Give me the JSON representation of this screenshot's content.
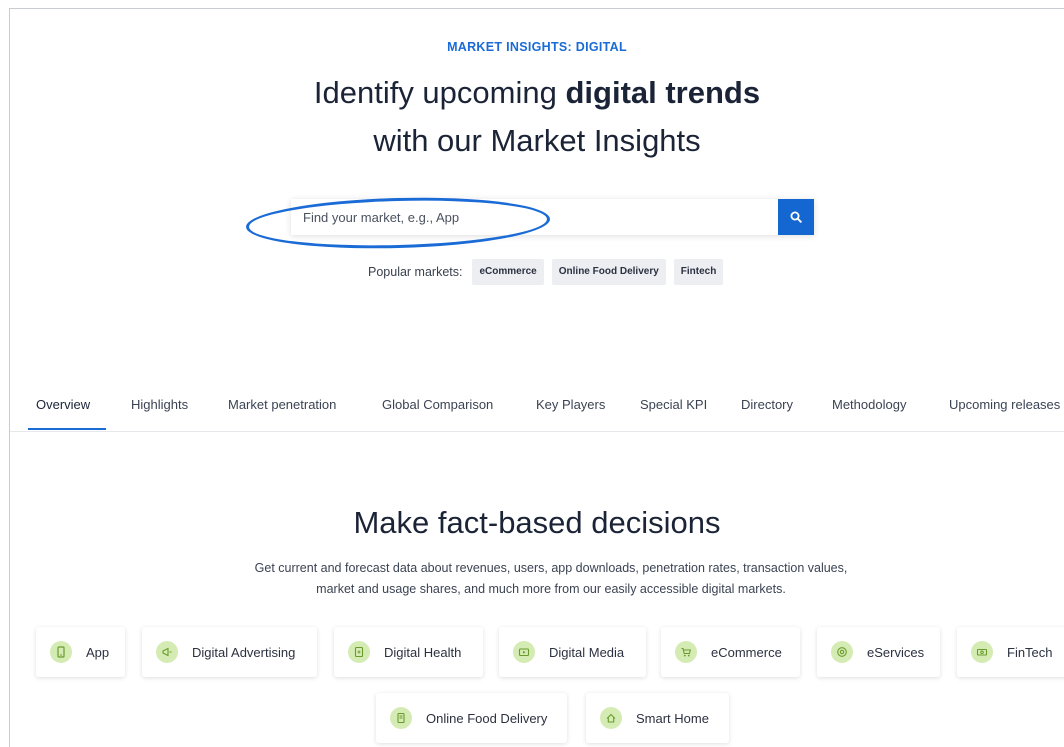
{
  "hero": {
    "eyebrow": "MARKET INSIGHTS: DIGITAL",
    "headline_pre": "Identify upcoming ",
    "headline_bold": "digital trends",
    "headline_line2": "with our Market Insights"
  },
  "search": {
    "value": "",
    "placeholder": "Find your market, e.g., App",
    "button_icon": "search-icon"
  },
  "popular": {
    "label": "Popular markets:",
    "chips": [
      "eCommerce",
      "Online Food Delivery",
      "Fintech"
    ]
  },
  "tabs": [
    {
      "label": "Overview",
      "active": true
    },
    {
      "label": "Highlights"
    },
    {
      "label": "Market penetration"
    },
    {
      "label": "Global Comparison"
    },
    {
      "label": "Key Players"
    },
    {
      "label": "Special KPI"
    },
    {
      "label": "Directory"
    },
    {
      "label": "Methodology"
    },
    {
      "label": "Upcoming releases"
    }
  ],
  "section": {
    "title": "Make fact-based decisions",
    "subtitle_line1": "Get current and forecast data about revenues, users, app downloads, penetration rates, transaction values,",
    "subtitle_line2": "market and usage shares, and much more from our easily accessible digital markets."
  },
  "markets": [
    {
      "label": "App",
      "icon": "phone-icon"
    },
    {
      "label": "Digital Advertising",
      "icon": "megaphone-icon"
    },
    {
      "label": "Digital Health",
      "icon": "health-device-icon"
    },
    {
      "label": "Digital Media",
      "icon": "media-icon"
    },
    {
      "label": "eCommerce",
      "icon": "cart-icon"
    },
    {
      "label": "eServices",
      "icon": "at-sign-icon"
    },
    {
      "label": "FinTech",
      "icon": "banknote-icon"
    },
    {
      "label": "Online Food Delivery",
      "icon": "food-delivery-icon"
    },
    {
      "label": "Smart Home",
      "icon": "smart-home-icon"
    }
  ],
  "colors": {
    "accent": "#1a6bd6",
    "search_button": "#1466d1",
    "icon_badge": "#d4ecb3",
    "icon_stroke": "#6a9a2c",
    "text_dark": "#1b2437"
  }
}
